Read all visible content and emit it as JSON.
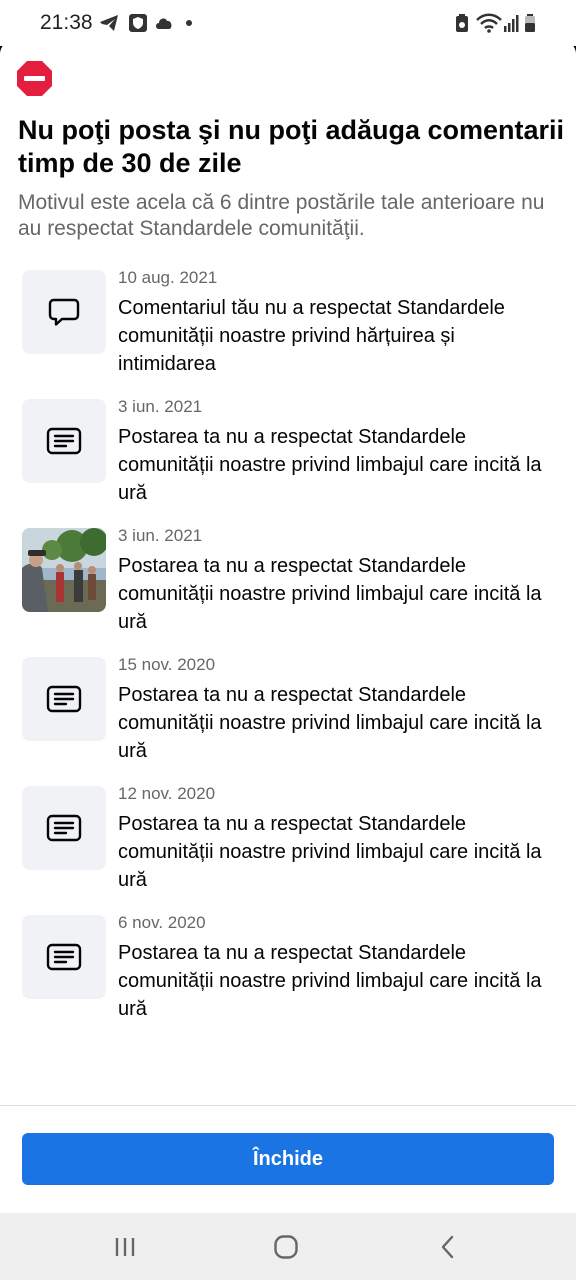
{
  "status_bar": {
    "time": "21:38",
    "notification_icons": [
      "telegram-icon",
      "shield-app-icon",
      "cloud-icon",
      "dot-icon"
    ],
    "system_icons": [
      "battery-saver-icon",
      "wifi-icon",
      "signal-icon",
      "battery-icon"
    ]
  },
  "dialog": {
    "icon": "stop-icon",
    "accent_color": "#e41e3f",
    "title": "Nu poţi posta şi nu poţi adăuga comentarii timp de 30 de zile",
    "subtitle": "Motivul este acela că 6 dintre postările tale anterioare nu au respectat Standardele comunităţii.",
    "items": [
      {
        "date": "10 aug. 2021",
        "text": "Comentariul tău nu a respectat Standardele comunității noastre privind hărțuirea și intimidarea",
        "icon": "comment-icon"
      },
      {
        "date": "3 iun. 2021",
        "text": "Postarea ta nu a respectat Standardele comunității noastre privind limbajul care incită la ură",
        "icon": "post-icon"
      },
      {
        "date": "3 iun. 2021",
        "text": "Postarea ta nu a respectat Standardele comunității noastre privind limbajul care incită la ură",
        "icon": "photo-thumbnail"
      },
      {
        "date": "15 nov. 2020",
        "text": "Postarea ta nu a respectat Standardele comunității noastre privind limbajul care incită la ură",
        "icon": "post-icon"
      },
      {
        "date": "12 nov. 2020",
        "text": "Postarea ta nu a respectat Standardele comunității noastre privind limbajul care incită la ură",
        "icon": "post-icon"
      },
      {
        "date": "6 nov. 2020",
        "text": "Postarea ta nu a respectat Standardele comunității noastre privind limbajul care incită la ură",
        "icon": "post-icon"
      }
    ],
    "close_label": "Închide",
    "button_color": "#1b74e4"
  },
  "nav_bar": {
    "buttons": [
      "recent-apps-icon",
      "home-icon",
      "back-icon"
    ]
  }
}
